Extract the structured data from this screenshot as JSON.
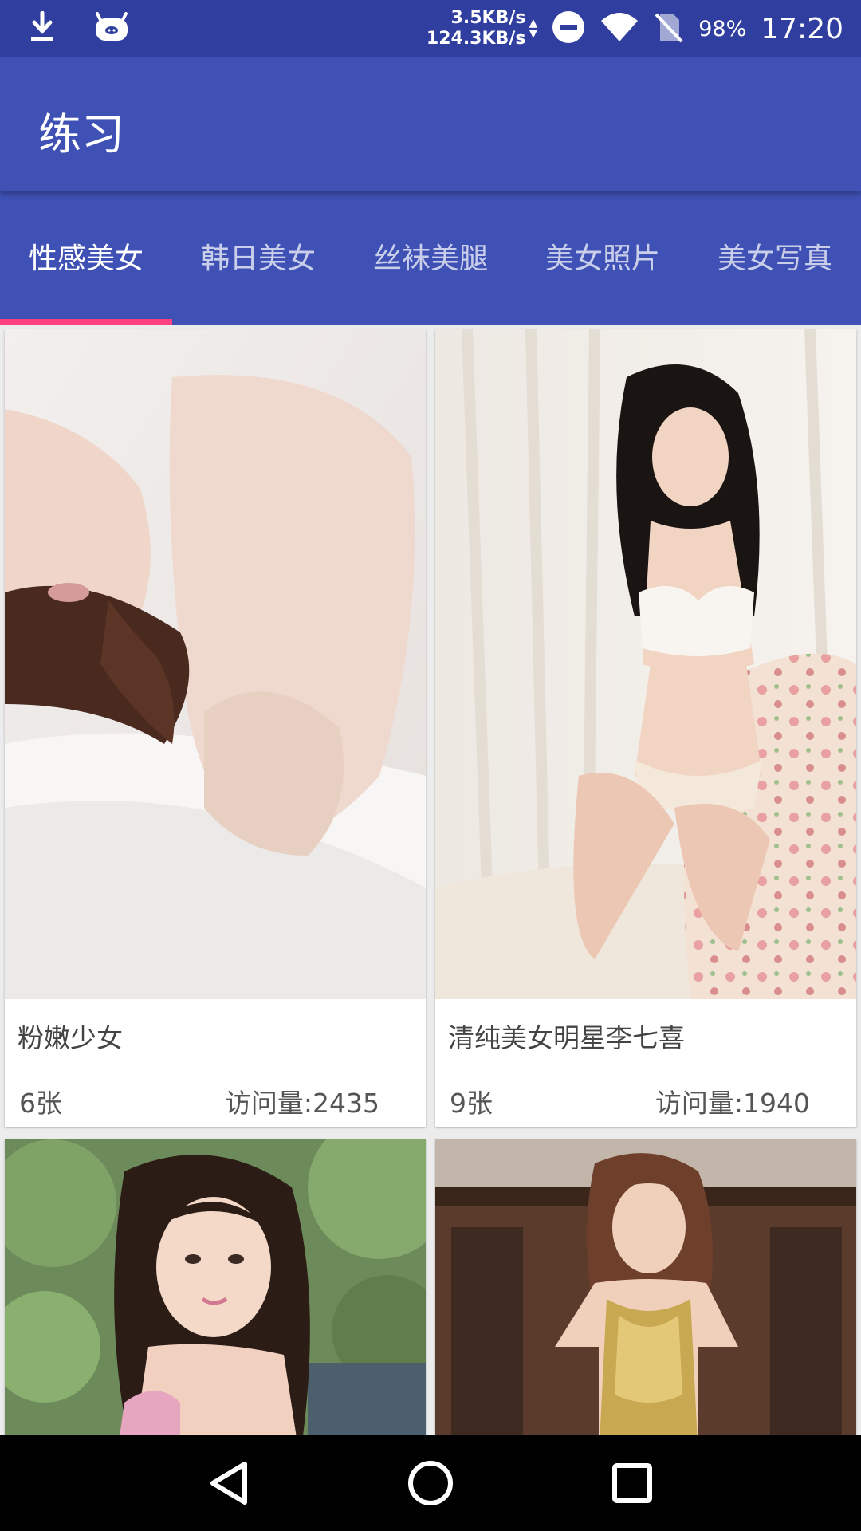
{
  "status_bar": {
    "net_up": "3.5KB/s",
    "net_down": "124.3KB/s",
    "battery": "98%",
    "time": "17:20",
    "icons": [
      "download-icon",
      "notification-app-icon",
      "dnd-icon",
      "wifi-icon",
      "no-sim-icon"
    ]
  },
  "app_bar": {
    "title": "练习"
  },
  "tabs": [
    {
      "label": "性感美女",
      "active": true
    },
    {
      "label": "韩日美女",
      "active": false
    },
    {
      "label": "丝袜美腿",
      "active": false
    },
    {
      "label": "美女照片",
      "active": false
    },
    {
      "label": "美女写真",
      "active": false
    }
  ],
  "colors": {
    "status_bar": "#303f9f",
    "primary": "#3f51b5",
    "accent": "#ff4081"
  },
  "albums": [
    {
      "title": "粉嫩少女",
      "count": "6张",
      "views": "访问量:2435"
    },
    {
      "title": "清纯美女明星李七喜",
      "count": "9张",
      "views": "访问量:1940"
    },
    {
      "title": "",
      "count": "",
      "views": ""
    },
    {
      "title": "",
      "count": "",
      "views": ""
    }
  ],
  "nav_bar": {
    "buttons": [
      "back-icon",
      "home-icon",
      "recents-icon"
    ]
  }
}
